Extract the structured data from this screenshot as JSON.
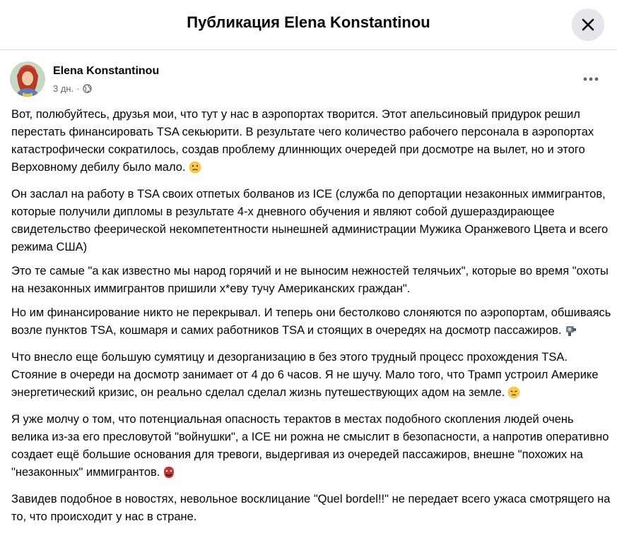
{
  "header": {
    "title": "Публикация Elena Konstantinou"
  },
  "post": {
    "author": "Elena Konstantinou",
    "time": "3 дн.",
    "separator": "·",
    "audience_icon": "globe-icon",
    "menu_icon": "more-options-icon",
    "paragraphs": [
      "Вот, полюбуйтесь, друзья мои, что тут у нас в аэропортах творится. Этот апельсиновый придурок решил перестать финансировать TSA секьюрити. В результате чего количество рабочего персонала в аэропортах катастрофически сократилось, создав проблему длиннющих очередей при досмотре на вылет, но и этого Верховному дебилу было мало.",
      "Он заслал на работу в TSA своих отпетых болванов из ICE (служба по депортации незаконных иммигрантов, которые получили дипломы в результате 4-х дневного обучения и являют собой душераздирающее свидетельство феерической некомпетентности нынешней администрации Мужика Оранжевого Цвета и всего режима США)",
      "Это те самые \"а как известно мы народ горячий и не выносим нежностей телячьих\", которые во время \"охоты на незаконных иммигрантов пришили х*еву тучу Американских граждан\".",
      "Но им финансирование никто не перекрывал. И теперь они бестолково слоняются по аэропортам, обшиваясь возле пунктов TSA, кошмаря и самих работников TSA и стоящих в очередях на досмотр пассажиров.",
      "Что внесло еще большую сумятицу и дезорганизацию в без этого трудный процесс прохождения TSA. Стояние в очереди на досмотр занимает от 4 до 6 часов. Я не шучу. Мало того, что Трамп устроил Америке энергетический кризис, он реально сделал сделал жизнь путешествующих адом на земле.",
      " Я уже молчу о том, что потенциальная опасность терактов в местах подобного скопления людей очень велика из-за его пресловутой \"войнушки\", а ICE  ни рожна не смыслит в безопасности, а напротив оперативно создает ещё большие основания для тревоги,  выдергивая из очередей пассажиров, внешне \"похожих на \"незаконных\" иммигрантов.",
      "Завидев подобное в новостях, невольное восклицание \"Quel bordel!!\" не передает всего ужаса смотрящего на то, что происходит у нас в стране."
    ],
    "emojis": [
      "worried-face-emoji",
      "robot-camera-emoji",
      "steam-face-emoji",
      "ogre-emoji"
    ]
  }
}
